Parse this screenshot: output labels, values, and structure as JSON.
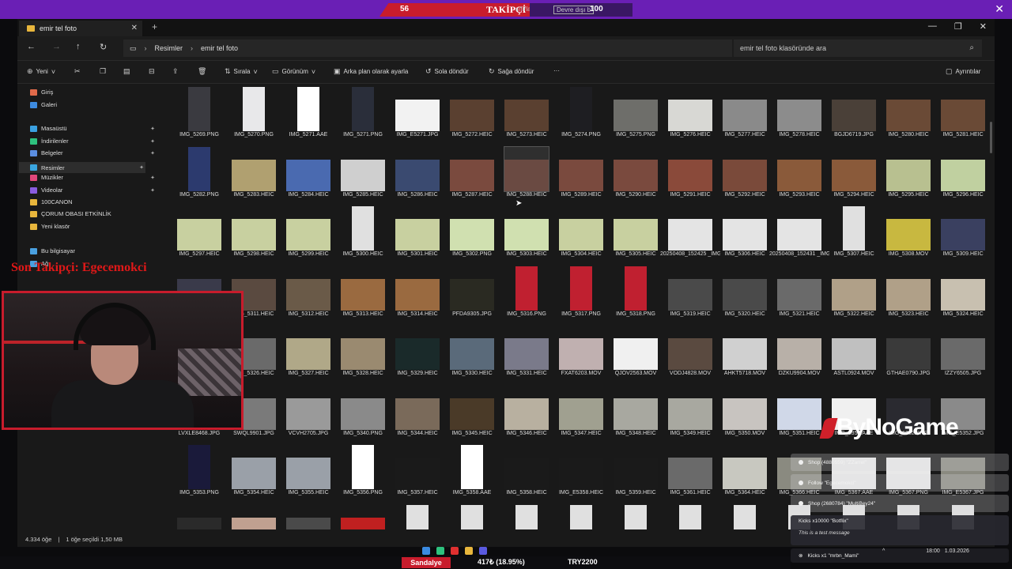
{
  "stream": {
    "left_count": "56",
    "title": "TAKİPÇİ",
    "sub_text": "sıfırlasaltıldı.",
    "sub_text2": "Devre dışı b",
    "right_count": "100",
    "last_follower": "Son Takipçi: Egecemokci",
    "brand": "ByNoGame",
    "ticker_label": "Sandalye",
    "ticker_pct": "417₺ (18.95%)",
    "ticker_goal": "TRY2200",
    "colors": {
      "accent_purple": "#6a1fb5",
      "accent_red": "#c81c2c"
    }
  },
  "notifications": [
    {
      "text": "Shop (4880559) \"ZZarrel\""
    },
    {
      "text": "Follow \"Egecemokci\""
    },
    {
      "text": "Shop (2680784) \"MultiBey24\""
    }
  ],
  "chat_notif": {
    "line1": "Kicks x10000 \"Botflix\"",
    "line2": "This is a test message"
  },
  "chat_notif2": "Kicks x1 \"mrbn_Mami\"",
  "tray_time": "18:00",
  "tray_date": "1.03.2026",
  "explorer": {
    "tab_title": "emir tel foto",
    "breadcrumb": [
      "Resimler",
      "emir tel foto"
    ],
    "search_placeholder": "emir tel foto klasöründe ara",
    "commands": {
      "new": "Yeni",
      "sort": "Sırala",
      "view": "Görünüm",
      "set_bg": "Arka plan olarak ayarla",
      "rotate_left": "Sola döndür",
      "rotate_right": "Sağa döndür",
      "more": "···",
      "details": "Ayrıntılar"
    },
    "sidebar": [
      {
        "label": "Giriş",
        "icon": "home-icon",
        "color": "#e06a4a"
      },
      {
        "label": "Galeri",
        "icon": "gallery-icon",
        "color": "#3d8be0"
      },
      {
        "label": "Masaüstü",
        "icon": "desktop-icon",
        "color": "#3aa0e0",
        "pinned": true
      },
      {
        "label": "İndirilenler",
        "icon": "download-icon",
        "color": "#2ec27e",
        "pinned": true
      },
      {
        "label": "Belgeler",
        "icon": "documents-icon",
        "color": "#5b8ee0",
        "pinned": true
      },
      {
        "label": "Resimler",
        "icon": "pictures-icon",
        "color": "#3aa6e0",
        "pinned": true,
        "selected": true
      },
      {
        "label": "Müzikler",
        "icon": "music-icon",
        "color": "#e0477a",
        "pinned": true
      },
      {
        "label": "Videolar",
        "icon": "videos-icon",
        "color": "#8a5ce0",
        "pinned": true
      },
      {
        "label": "100CANON",
        "icon": "folder-icon",
        "color": "#e8b63c"
      },
      {
        "label": "ÇORUM OBASI ETKİNLİK",
        "icon": "folder-icon",
        "color": "#e8b63c"
      },
      {
        "label": "Yeni klasör",
        "icon": "folder-icon",
        "color": "#e8b63c"
      },
      {
        "label": "Bu bilgisayar",
        "icon": "pc-icon",
        "color": "#4aa0e0"
      },
      {
        "label": "Ağ",
        "icon": "network-icon",
        "color": "#4aa0e0"
      }
    ],
    "rows": [
      [
        "IMG_5269.PNG",
        "IMG_5270.PNG",
        "IMG_5271.AAE",
        "IMG_5271.PNG",
        "IMG_E5271.JPG",
        "IMG_5272.HEIC",
        "IMG_5273.HEIC",
        "IMG_5274.PNG",
        "IMG_5275.PNG",
        "IMG_5276.HEIC",
        "IMG_5277.HEIC",
        "IMG_5278.HEIC",
        "BGJD6719.JPG",
        "IMG_5280.HEIC",
        "IMG_5281.HEIC"
      ],
      [
        "IMG_5282.PNG",
        "IMG_5283.HEIC",
        "IMG_5284.HEIC",
        "IMG_5285.HEIC",
        "IMG_5286.HEIC",
        "IMG_5287.HEIC",
        "IMG_5288.HEIC",
        "IMG_5289.HEIC",
        "IMG_5290.HEIC",
        "IMG_5291.HEIC",
        "IMG_5292.HEIC",
        "IMG_5293.HEIC",
        "IMG_5294.HEIC",
        "IMG_5295.HEIC",
        "IMG_5296.HEIC"
      ],
      [
        "IMG_5297.HEIC",
        "IMG_5298.HEIC",
        "IMG_5299.HEIC",
        "IMG_5300.HEIC",
        "IMG_5301.HEIC",
        "IMG_5302.PNG",
        "IMG_5303.HEIC",
        "IMG_5304.HEIC",
        "IMG_5305.HEIC",
        "20250408_152425 _IMG_5306.HEIC",
        "IMG_5306.HEIC",
        "20250408_152431 _IMG_5307.HEIC",
        "IMG_5307.HEIC",
        "IMG_5308.MOV",
        "IMG_5309.HEIC"
      ],
      [
        "IMG_5310.HEIC",
        "IMG_5311.HEIC",
        "IMG_5312.HEIC",
        "IMG_5313.HEIC",
        "IMG_5314.HEIC",
        "PFDA9305.JPG",
        "IMG_5316.PNG",
        "IMG_5317.PNG",
        "IMG_5318.PNG",
        "IMG_5319.HEIC",
        "IMG_5320.HEIC",
        "IMG_5321.HEIC",
        "IMG_5322.HEIC",
        "IMG_5323.HEIC",
        "IMG_5324.HEIC"
      ],
      [
        "IMG_5325.HEIC",
        "IMG_5326.HEIC",
        "IMG_5327.HEIC",
        "IMG_5328.HEIC",
        "IMG_5329.HEIC",
        "IMG_5330.HEIC",
        "IMG_5331.HEIC",
        "FXAT6203.MOV",
        "QJOV2563.MOV",
        "VODJ4828.MOV",
        "AHKT5718.MOV",
        "DZKU9904.MOV",
        "ASTL0924.MOV",
        "GTHAE0790.JPG",
        "IZZY6505.JPG"
      ],
      [
        "LVXLE8468.JPG",
        "SWQL9901.JPG",
        "VCVH2705.JPG",
        "IMG_5340.PNG",
        "IMG_5344.HEIC",
        "IMG_5345.HEIC",
        "IMG_5346.HEIC",
        "IMG_5347.HEIC",
        "IMG_5348.HEIC",
        "IMG_5349.HEIC",
        "IMG_5350.MOV",
        "IMG_5351.HEIC",
        "IMG_5352.AAE",
        "IMG_5352.PNG",
        "IMG_E5352.JPG"
      ],
      [
        "IMG_5353.PNG",
        "IMG_5354.HEIC",
        "IMG_5355.HEIC",
        "IMG_5356.PNG",
        "IMG_5357.HEIC",
        "IMG_5358.AAE",
        "IMG_5358.HEIC",
        "IMG_E5358.HEIC",
        "IMG_5359.HEIC",
        "IMG_5361.HEIC",
        "IMG_5364.HEIC",
        "IMG_5366.HEIC",
        "IMG_5367.AAE",
        "IMG_5367.PNG",
        "IMG_E5367.JPG"
      ],
      [
        "",
        "",
        "",
        "",
        "",
        "",
        "",
        "",
        "",
        "",
        "",
        "",
        "",
        "",
        ""
      ]
    ],
    "thumb_colors": [
      [
        "#3a3a40",
        "#e8e8ea",
        "#ffffff",
        "#2a2e3a",
        "#f2f2f2",
        "#5a4030",
        "#5a4030",
        "#1e1e22",
        "#6e6e6a",
        "#d8d8d4",
        "#8a8a8a",
        "#8c8c8c",
        "#4a4038",
        "#6a4a36",
        "#6a4a36"
      ],
      [
        "#2c3a6e",
        "#b0a070",
        "#4a6ab0",
        "#cfcfcf",
        "#3a4a70",
        "#7a4a3e",
        "#6a4a42",
        "#7a4a3e",
        "#7a4a3e",
        "#8a4a3a",
        "#7a4a3a",
        "#8a5a3a",
        "#8a5a3a",
        "#b8c090",
        "#c0d0a0"
      ],
      [
        "#c8d0a0",
        "#c8d0a0",
        "#c8d0a0",
        "#e0e0e0",
        "#c8d0a0",
        "#d0e0b0",
        "#d0e0b0",
        "#c8d0a0",
        "#c8d0a0",
        "#e4e4e4",
        "#e4e4e4",
        "#e4e4e4",
        "#e0e0e0",
        "#c8b840",
        "#3a4060"
      ],
      [
        "#3a3a4a",
        "#5a4a40",
        "#6a5a48",
        "#9a6a40",
        "#9a6a40",
        "#2a2a22",
        "#c02030",
        "#c02030",
        "#c02030",
        "#4a4a4a",
        "#4a4a4a",
        "#6a6a6a",
        "#b0a088",
        "#b0a088",
        "#c8c0b0"
      ],
      [
        "#5a5a5a",
        "#6a6a6a",
        "#b0a888",
        "#9a8a70",
        "#1a2a2a",
        "#5a6a7a",
        "#7a7a8a",
        "#c0b0b0",
        "#f0f0f0",
        "#5a4a40",
        "#d0d0d0",
        "#b8b0a8",
        "#c0c0c0",
        "#3a3a3a",
        "#6a6a6a"
      ],
      [
        "#6a6a6a",
        "#7a7a7a",
        "#9a9a9a",
        "#8a8a8a",
        "#7a6a5a",
        "#4a3a28",
        "#b8b0a0",
        "#a0a090",
        "#a8a8a0",
        "#a8a8a0",
        "#c8c4c0",
        "#d0d8e8",
        "#f0f0f0",
        "#2a2a30",
        "#8a8a8a"
      ],
      [
        "#1a1a3a",
        "#9aa0a8",
        "#9aa0a8",
        "#ffffff",
        "#1a1a1a",
        "#ffffff",
        "#1a1a1a",
        "#1a1a1a",
        "#1a1a1a",
        "#6a6a6a",
        "#c8c8c0",
        "#8a8a80",
        "#e8e8e8",
        "#e8e8e8",
        "#8a8a80"
      ],
      [
        "#2a2a2a",
        "#c0a090",
        "#4a4a4a",
        "#c02020",
        "#e0e0e0",
        "#e0e0e0",
        "#e0e0e0",
        "#e0e0e0",
        "#e0e0e0",
        "#e0e0e0",
        "#e0e0e0",
        "#e0e0e0",
        "#e0e0e0",
        "#e0e0e0",
        "#e0e0e0"
      ]
    ],
    "selected_file": "IMG_5288.HEIC",
    "status": {
      "items": "4.334 öğe",
      "selected": "1 öğe seçildi  1,50 MB"
    }
  }
}
